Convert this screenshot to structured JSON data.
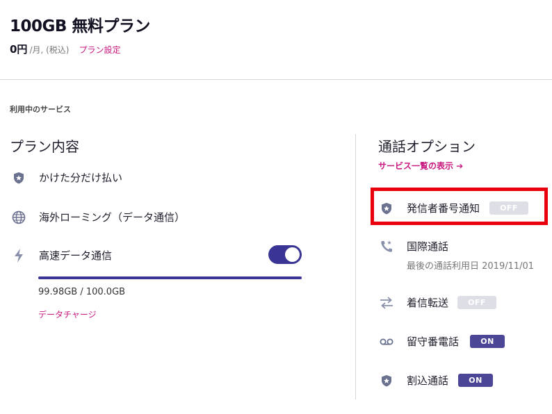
{
  "plan": {
    "title": "100GB 無料プラン",
    "price": "0円",
    "price_unit": "/月, (税込)",
    "settings_link": "プラン設定"
  },
  "services_heading": "利用中のサービス",
  "plan_content": {
    "title": "プラン内容",
    "items": [
      {
        "label": "かけた分だけ払い",
        "icon": "shield-star-icon"
      },
      {
        "label": "海外ローミング（データ通信）",
        "icon": "globe-icon"
      },
      {
        "label": "高速データ通信",
        "icon": "lightning-icon",
        "toggle": "on"
      }
    ],
    "data_usage": {
      "text": "99.98GB / 100.0GB",
      "used_gb": 99.98,
      "total_gb": 100.0,
      "fraction_remaining": 0.9998
    },
    "charge_link": "データチャージ"
  },
  "call_options": {
    "title": "通話オプション",
    "service_list_link": "サービス一覧の表示 ➔",
    "items": [
      {
        "label": "発信者番号通知",
        "icon": "shield-star-icon",
        "state": "OFF",
        "highlighted": true
      },
      {
        "label": "国際通話",
        "icon": "phone-star-icon",
        "sub": "最後の通話利用日 2019/11/01"
      },
      {
        "label": "着信転送",
        "icon": "transfer-arrows-icon",
        "state": "OFF"
      },
      {
        "label": "留守番電話",
        "icon": "voicemail-icon",
        "state": "ON"
      },
      {
        "label": "割込通話",
        "icon": "shield-star-icon",
        "state": "ON"
      }
    ]
  },
  "colors": {
    "accent": "#c8177e",
    "primary": "#3a3594",
    "badge_on": "#4b4796",
    "badge_off": "#dedfe6",
    "icon": "#6b7290",
    "highlight": "#e8000e"
  }
}
